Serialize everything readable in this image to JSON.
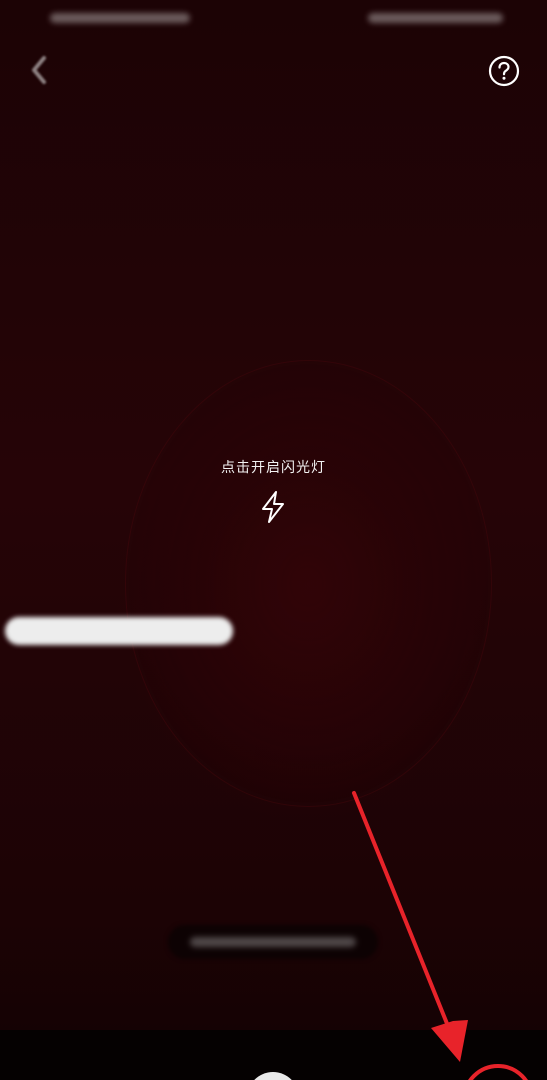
{
  "header": {
    "back_icon": "chevron-left-icon",
    "help_icon": "question-circle-icon"
  },
  "scan": {
    "flash_hint": "点击开启闪光灯",
    "flash_icon": "lightning-bolt-icon"
  },
  "colors": {
    "background": "#1a0306",
    "annotation": "#e8232a"
  }
}
